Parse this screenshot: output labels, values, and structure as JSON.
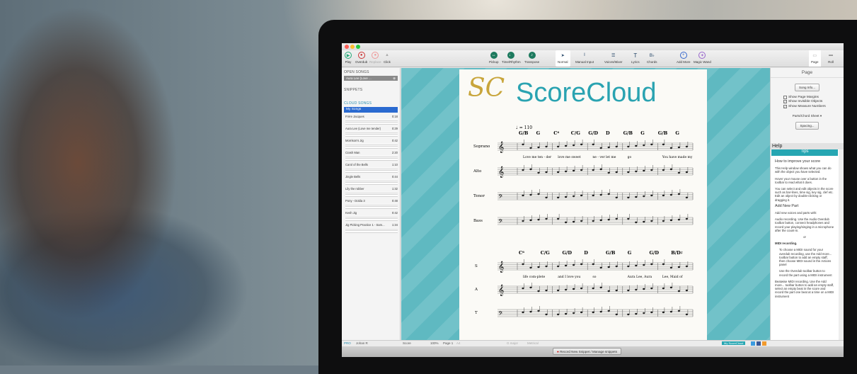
{
  "toolbar": {
    "play": "Play",
    "overdub": "Overdub",
    "replace": "Replace",
    "click": "Click",
    "pickup": "Pickup",
    "time_rhythm": "Time/Rhythm",
    "transpose": "Transpose",
    "normal": "Normal",
    "manual_input": "Manual Input",
    "voices_mixer": "Voices/Mixer",
    "lyrics": "Lyrics",
    "chords": "Chords",
    "add_more": "Add More",
    "magic_wand": "Magic Wand",
    "page": "Page",
    "roll": "Roll"
  },
  "left": {
    "open_songs": "OPEN SONGS",
    "open_song": "Aura Lee (Love ...",
    "snippets": "SNIPPETS",
    "cloud_songs": "CLOUD SONGS",
    "filter": "My Songs",
    "songs": [
      {
        "t": "Frère Jacques",
        "d": "0:18"
      },
      {
        "t": "Aura Lee (Love me tender)",
        "d": "0:29"
      },
      {
        "t": "Morrison's Jig",
        "d": "0:42"
      },
      {
        "t": "Crash Man",
        "d": "2:20"
      },
      {
        "t": "Carol of the Bells",
        "d": "1:10"
      },
      {
        "t": "Jingle Bells",
        "d": "0:44"
      },
      {
        "t": "Lily the robber",
        "d": "1:32"
      },
      {
        "t": "Pony - Dolda 3",
        "d": "0:48"
      },
      {
        "t": "Kesh Jig",
        "d": "0:42"
      },
      {
        "t": "Jig Picking Practice 1 - Sam...",
        "d": "1:34"
      }
    ]
  },
  "score": {
    "logo": "ScoreCloud",
    "tempo": "♩ = 110",
    "chords1": [
      "G/B",
      "G",
      "C⁶",
      "C/G",
      "G/D",
      "D",
      "G/B",
      "G",
      "G/B",
      "G"
    ],
    "lyrics1": [
      "Love me ten - der",
      "love me sweet",
      "ne - ver let me",
      "go",
      "You have made my"
    ],
    "parts1": [
      "Soprano",
      "Alto",
      "Tenor",
      "Bass"
    ],
    "chords2": [
      "C⁶",
      "C/G",
      "G/D",
      "D",
      "G/B",
      "G",
      "G/D",
      "B/D♯"
    ],
    "lyrics2": [
      "life com-plete",
      "and I love you",
      "so",
      "Aura Lee, Aura",
      "Lee, Maid of"
    ],
    "parts2": [
      "S",
      "A",
      "T"
    ]
  },
  "right": {
    "title": "Page",
    "song_info": "Song Info...",
    "show_margins": "Show Page Margins",
    "show_invisible": "Show Invisible Objects",
    "show_measures": "Show Measure Numbers",
    "sheet_type": "Parts/Chord Sheet",
    "spacing": "Spacing...",
    "help_label": "Help",
    "tips": "Tips",
    "h1": "How to improve your score",
    "p1": "This Help window shows what you can do with the object you have selected.",
    "p2": "Hover your mouse over a button in the toolbar to read what it does.",
    "p3": "You can select and edit objects in the score such as bar-lines, time sig, key sig, clef etc. Edit an object by double-clicking or dragging it.",
    "h2": "Add New Part",
    "p4": "Add new voices and parts with:",
    "p5": "Audio recording. Use the Audio Overdub toolbar button, connect headphones and record your playing/singing in a microphone after the count-in.",
    "or": "or",
    "p6": "MIDI recording.",
    "b1": "To choose a MIDI sound for your overdub recording, use the Add more... toolbar button to add an empty staff, then choose MIDI sound in the Actions panel",
    "b2": "Use the Overdub toolbar button to record the part using a MIDI instrument",
    "p7": "Beatwise MIDI recording. Use the Add more... toolbar button to add an empty staff, select an empty beat in the score and record the part one beat at a time on a MIDI instrument"
  },
  "status": {
    "pro": "PRO",
    "user": "Johan R",
    "view": "Score",
    "zoom": "100%",
    "page": "Page 1",
    "paper": "A4",
    "key": "G major",
    "meter": "Metrical",
    "my_scorecloud": "My ScoreCloud"
  },
  "bottom": {
    "record": "Record New Snippet / Manage snippets"
  }
}
